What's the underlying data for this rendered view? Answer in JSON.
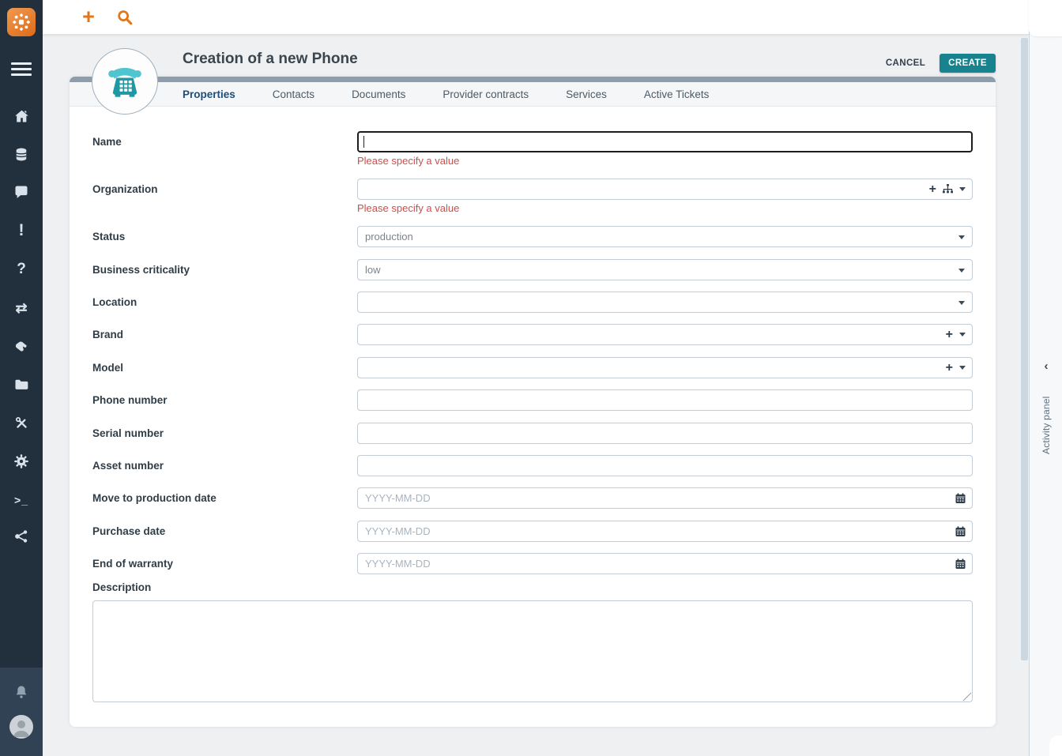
{
  "colors": {
    "accent_orange": "#e1761b",
    "teal_button": "#17838f",
    "sidebar_bg": "#22303d",
    "sidebar_bottom_bg": "#304254",
    "card_state_strip": "#8d9dac",
    "error_red": "#cb4f4c",
    "tab_active": "#1c4e7b",
    "phone_icon_teal": "#1f98a3",
    "scrollbar_thumb": "#ccd7e0"
  },
  "topbar": {
    "plus_glyph": "+",
    "search_icon": "search-icon"
  },
  "sidebar": {
    "logo_icon": "itop-logo",
    "items": [
      {
        "icon": "home-icon"
      },
      {
        "icon": "database-icon"
      },
      {
        "icon": "comment-icon"
      },
      {
        "icon": "exclamation-icon",
        "glyph": "!"
      },
      {
        "icon": "question-icon",
        "glyph": "?"
      },
      {
        "icon": "transfer-arrows-icon",
        "glyph": "⇄"
      },
      {
        "icon": "hand-holding-icon"
      },
      {
        "icon": "folder-icon"
      },
      {
        "icon": "tools-icon"
      },
      {
        "icon": "gear-icon"
      },
      {
        "icon": "terminal-icon",
        "glyph": ">_"
      },
      {
        "icon": "share-nodes-icon"
      }
    ],
    "bell_icon": "bell-icon",
    "avatar_icon": "user-avatar"
  },
  "header": {
    "title": "Creation of a new Phone",
    "object_icon": "phone-icon",
    "cancel_label": "CANCEL",
    "create_label": "CREATE"
  },
  "tabs": [
    {
      "label": "Properties",
      "active": true
    },
    {
      "label": "Contacts",
      "active": false
    },
    {
      "label": "Documents",
      "active": false
    },
    {
      "label": "Provider contracts",
      "active": false
    },
    {
      "label": "Services",
      "active": false
    },
    {
      "label": "Active Tickets",
      "active": false
    }
  ],
  "form": {
    "fields": [
      {
        "label": "Name",
        "type": "text",
        "value": "",
        "error": "Please specify a value"
      },
      {
        "label": "Organization",
        "type": "autocomplete",
        "value": "",
        "error": "Please specify a value",
        "icons": [
          "plus-icon",
          "hierarchy-icon",
          "caret-down-icon"
        ]
      },
      {
        "label": "Status",
        "type": "select",
        "value": "production"
      },
      {
        "label": "Business criticality",
        "type": "select",
        "value": "low"
      },
      {
        "label": "Location",
        "type": "select",
        "value": ""
      },
      {
        "label": "Brand",
        "type": "autocomplete",
        "value": "",
        "icons": [
          "plus-icon",
          "caret-down-icon"
        ]
      },
      {
        "label": "Model",
        "type": "autocomplete",
        "value": "",
        "icons": [
          "plus-icon",
          "caret-down-icon"
        ]
      },
      {
        "label": "Phone number",
        "type": "text",
        "value": ""
      },
      {
        "label": "Serial number",
        "type": "text",
        "value": ""
      },
      {
        "label": "Asset number",
        "type": "text",
        "value": ""
      },
      {
        "label": "Move to production date",
        "type": "date",
        "value": "",
        "placeholder": "YYYY-MM-DD"
      },
      {
        "label": "Purchase date",
        "type": "date",
        "value": "",
        "placeholder": "YYYY-MM-DD"
      },
      {
        "label": "End of warranty",
        "type": "date",
        "value": "",
        "placeholder": "YYYY-MM-DD"
      },
      {
        "label": "Description",
        "type": "textarea",
        "value": ""
      }
    ]
  },
  "activity_panel": {
    "collapse_glyph": "‹",
    "label": "Activity panel"
  }
}
